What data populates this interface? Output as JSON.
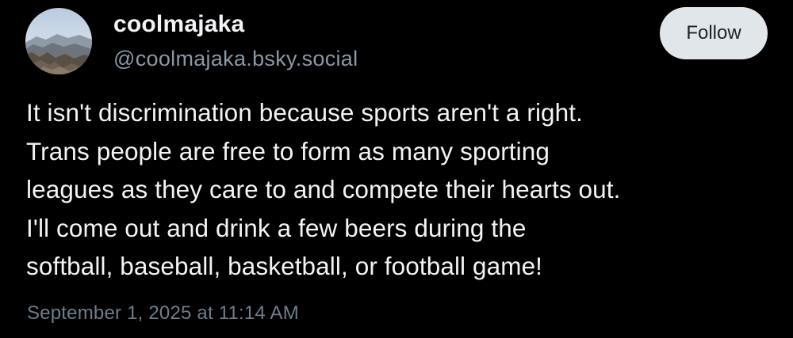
{
  "post": {
    "author": {
      "display_name": "coolmajaka",
      "handle": "@coolmajaka.bsky.social",
      "avatar_icon": "avatar-mountain-landscape"
    },
    "follow_label": "Follow",
    "text": "It isn't discrimination because sports aren't a right.\nTrans people are free to form as many sporting\nleagues as they care to and compete their hearts out.\nI'll come out and drink a few beers during the\nsoftball, baseball, basketball, or football game!",
    "timestamp": "September 1, 2025 at 11:14 AM"
  },
  "colors": {
    "background": "#000000",
    "text_primary": "#f1f3f5",
    "text_secondary": "#8b98a5",
    "timestamp": "#6e7d8c",
    "follow_button_bg": "#e1e6ea",
    "follow_button_text": "#1a2128"
  }
}
